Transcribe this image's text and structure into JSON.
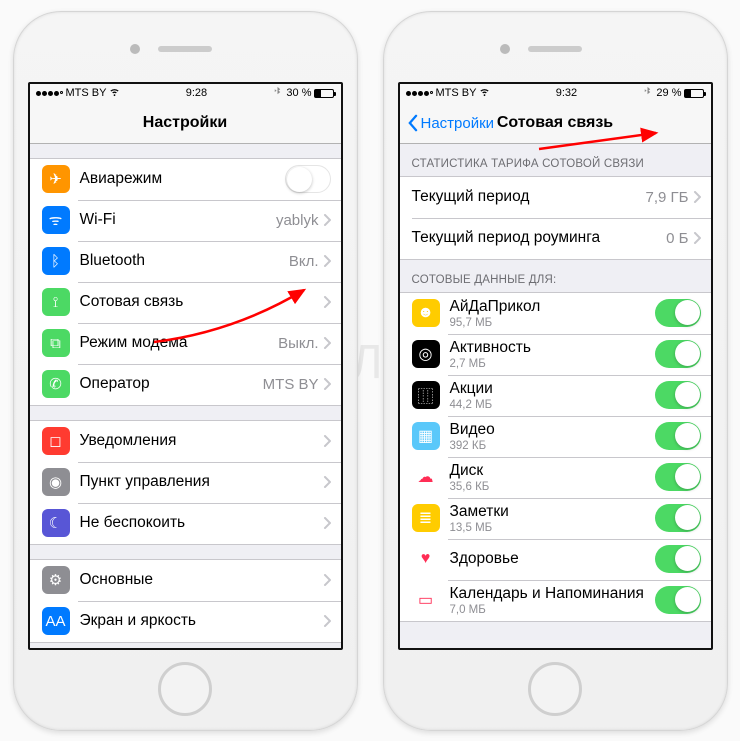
{
  "left": {
    "statusbar": {
      "carrier": "MTS BY",
      "time": "9:28",
      "battery": "30 %"
    },
    "navbar": {
      "title": "Настройки"
    },
    "group1": [
      {
        "icon": "airplane-icon",
        "bg": "bg-orange",
        "glyph": "✈",
        "label": "Авиарежим",
        "control": "switch-off"
      },
      {
        "icon": "wifi-icon",
        "bg": "bg-blue",
        "glyph": "ᯤ",
        "label": "Wi-Fi",
        "value": "yablyk"
      },
      {
        "icon": "bluetooth-icon",
        "bg": "bg-blue",
        "glyph": "ᛒ",
        "label": "Bluetooth",
        "value": "Вкл."
      },
      {
        "icon": "cellular-icon",
        "bg": "bg-green",
        "glyph": "⟟",
        "label": "Сотовая связь",
        "value": ""
      },
      {
        "icon": "hotspot-icon",
        "bg": "bg-green",
        "glyph": "⧉",
        "label": "Режим модема",
        "value": "Выкл."
      },
      {
        "icon": "carrier-icon",
        "bg": "bg-green",
        "glyph": "✆",
        "label": "Оператор",
        "value": "MTS BY"
      }
    ],
    "group2": [
      {
        "icon": "notifications-icon",
        "bg": "bg-red",
        "glyph": "◻",
        "label": "Уведомления"
      },
      {
        "icon": "control-center-icon",
        "bg": "bg-gray",
        "glyph": "◉",
        "label": "Пункт управления"
      },
      {
        "icon": "dnd-icon",
        "bg": "bg-indigo",
        "glyph": "☾",
        "label": "Не беспокоить"
      }
    ],
    "group3": [
      {
        "icon": "general-icon",
        "bg": "bg-gray",
        "glyph": "⚙",
        "label": "Основные"
      },
      {
        "icon": "display-icon",
        "bg": "bg-blue",
        "glyph": "AA",
        "label": "Экран и яркость"
      }
    ]
  },
  "right": {
    "statusbar": {
      "carrier": "MTS BY",
      "time": "9:32",
      "battery": "29 %"
    },
    "navbar": {
      "back": "Настройки",
      "title": "Сотовая связь"
    },
    "statsHeader": "СТАТИСТИКА ТАРИФА СОТОВОЙ СВЯЗИ",
    "stats": [
      {
        "label": "Текущий период",
        "value": "7,9 ГБ"
      },
      {
        "label": "Текущий период роуминга",
        "value": "0 Б"
      }
    ],
    "appsHeader": "СОТОВЫЕ ДАННЫЕ ДЛЯ:",
    "apps": [
      {
        "icon": "app-aidaprikol-icon",
        "bg": "bg-yellow",
        "glyph": "☻",
        "label": "АйДаПрикол",
        "sub": "95,7 МБ"
      },
      {
        "icon": "app-activity-icon",
        "bg": "bg-black",
        "glyph": "◎",
        "label": "Активность",
        "sub": "2,7 МБ"
      },
      {
        "icon": "app-stocks-icon",
        "bg": "bg-black",
        "glyph": "⿲",
        "label": "Акции",
        "sub": "44,2 МБ"
      },
      {
        "icon": "app-videos-icon",
        "bg": "bg-teal",
        "glyph": "▦",
        "label": "Видео",
        "sub": "392 КБ"
      },
      {
        "icon": "app-drive-icon",
        "bg": "bg-white",
        "glyph": "☁",
        "label": "Диск",
        "sub": "35,6 КБ"
      },
      {
        "icon": "app-notes-icon",
        "bg": "bg-yellow",
        "glyph": "≣",
        "label": "Заметки",
        "sub": "13,5 МБ"
      },
      {
        "icon": "app-health-icon",
        "bg": "bg-white",
        "glyph": "♥",
        "label": "Здоровье",
        "sub": ""
      },
      {
        "icon": "app-calendar-icon",
        "bg": "bg-white",
        "glyph": "▭",
        "label": "Календарь и Напоминания",
        "sub": "7,0 МБ"
      }
    ]
  }
}
